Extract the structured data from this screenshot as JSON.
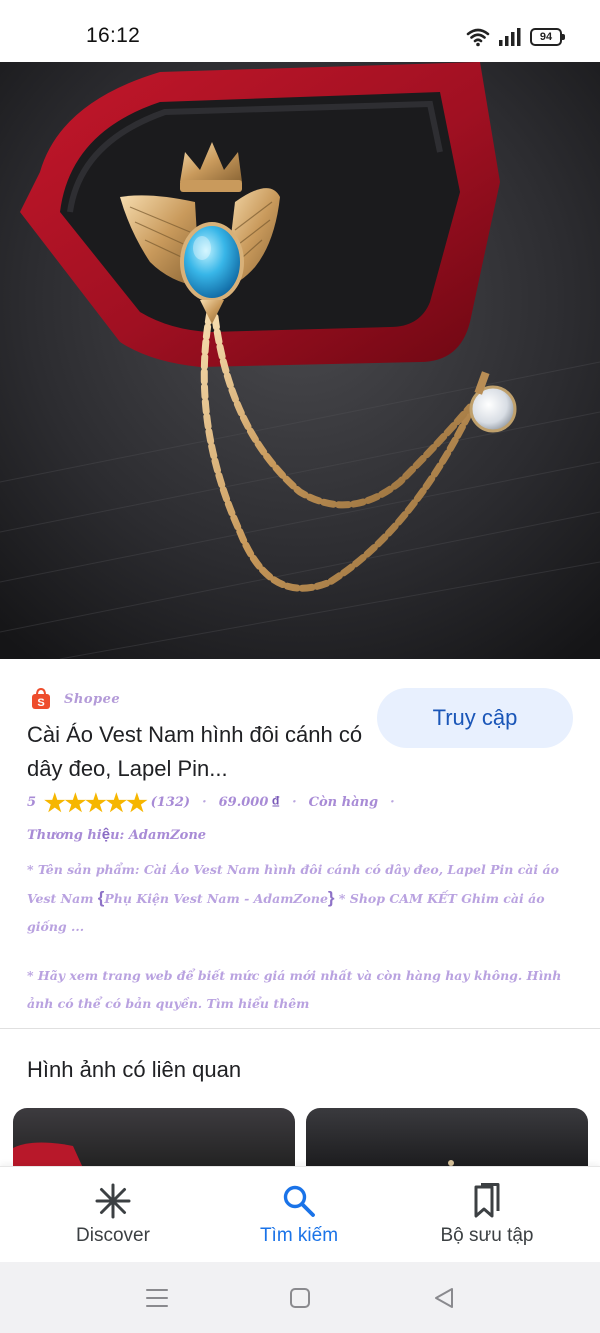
{
  "status_bar": {
    "time": "16:12",
    "battery": "94",
    "icons": [
      "wifi-icon",
      "signal-icon",
      "battery-icon"
    ]
  },
  "hero": {
    "icons": [
      "brooch-photo"
    ]
  },
  "product": {
    "source": "Shopee",
    "visit_button": "Truy cập",
    "title": "Cài Áo Vest Nam hình đôi cánh có dây đeo, Lapel Pin...",
    "rating_value": "5",
    "stars": "★★★★★",
    "review_count": "(132)",
    "price": "69.000",
    "currency": "₫",
    "stock": "Còn hàng",
    "brand_prefix": "Thương hi",
    "brand_accent": "ệ",
    "brand_suffix": "u: AdamZone",
    "desc1_a": "* Tên sản phẩm: Cài Áo Vest Nam hình đôi cánh có dây đeo, Lapel Pin cài áo Vest Nam ",
    "desc1_brace_open": "{",
    "desc1_b": "Phụ Kiện Vest Nam - AdamZone",
    "desc1_brace_close": "}",
    "desc1_c": " * Shop CAM KẾT Ghim cài áo giống ...",
    "desc2": "* Hãy xem trang web để biết mức giá mới nhất và còn hàng hay không. Hình ảnh có thể có bản quyền. Tìm hiểu thêm",
    "colors": {
      "star": "#f6b600",
      "button_bg": "#e8f0fe",
      "button_text": "#1a56b8"
    }
  },
  "related": {
    "title": "Hình ảnh có liên quan"
  },
  "bottom_nav": {
    "items": [
      {
        "label": "Discover",
        "icon": "asterisk-icon",
        "active": false
      },
      {
        "label": "Tìm kiếm",
        "icon": "search-icon",
        "active": true
      },
      {
        "label": "Bộ sưu tập",
        "icon": "collections-icon",
        "active": false
      }
    ],
    "active_color": "#1a73e8"
  },
  "system_nav": {
    "icons": [
      "menu-icon",
      "home-icon",
      "back-icon"
    ]
  }
}
